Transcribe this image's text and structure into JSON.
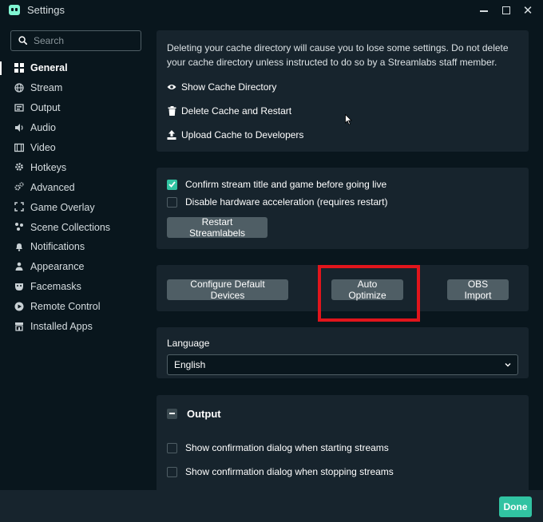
{
  "window": {
    "title": "Settings"
  },
  "sidebar": {
    "search_placeholder": "Search",
    "items": [
      {
        "label": "General",
        "icon": "grid-icon",
        "active": true
      },
      {
        "label": "Stream",
        "icon": "globe-icon"
      },
      {
        "label": "Output",
        "icon": "output-icon"
      },
      {
        "label": "Audio",
        "icon": "speaker-icon"
      },
      {
        "label": "Video",
        "icon": "film-icon"
      },
      {
        "label": "Hotkeys",
        "icon": "gear-icon"
      },
      {
        "label": "Advanced",
        "icon": "cogs-icon"
      },
      {
        "label": "Game Overlay",
        "icon": "overlay-icon"
      },
      {
        "label": "Scene Collections",
        "icon": "collections-icon"
      },
      {
        "label": "Notifications",
        "icon": "bell-icon"
      },
      {
        "label": "Appearance",
        "icon": "person-icon"
      },
      {
        "label": "Facemasks",
        "icon": "mask-icon"
      },
      {
        "label": "Remote Control",
        "icon": "play-circle-icon"
      },
      {
        "label": "Installed Apps",
        "icon": "store-icon"
      }
    ]
  },
  "cache": {
    "description": "Deleting your cache directory will cause you to lose some settings. Do not delete your cache directory unless instructed to do so by a Streamlabs staff member.",
    "show_label": "Show Cache Directory",
    "delete_label": "Delete Cache and Restart",
    "upload_label": "Upload Cache to Developers"
  },
  "general": {
    "confirm_title_label": "Confirm stream title and game before going live",
    "confirm_title_checked": true,
    "disable_hw_label": "Disable hardware acceleration (requires restart)",
    "disable_hw_checked": false,
    "restart_label": "Restart Streamlabels"
  },
  "devices": {
    "configure_label": "Configure Default Devices",
    "auto_optimize_label": "Auto Optimize",
    "obs_import_label": "OBS Import"
  },
  "language": {
    "label": "Language",
    "selected": "English"
  },
  "output": {
    "title": "Output",
    "start_confirm_label": "Show confirmation dialog when starting streams",
    "stop_confirm_label": "Show confirmation dialog when stopping streams"
  },
  "footer": {
    "done_label": "Done"
  },
  "colors": {
    "accent": "#31c3a2",
    "highlight": "#e1151c",
    "background": "#09161d",
    "card": "#17242d",
    "button": "#4f5e65"
  }
}
